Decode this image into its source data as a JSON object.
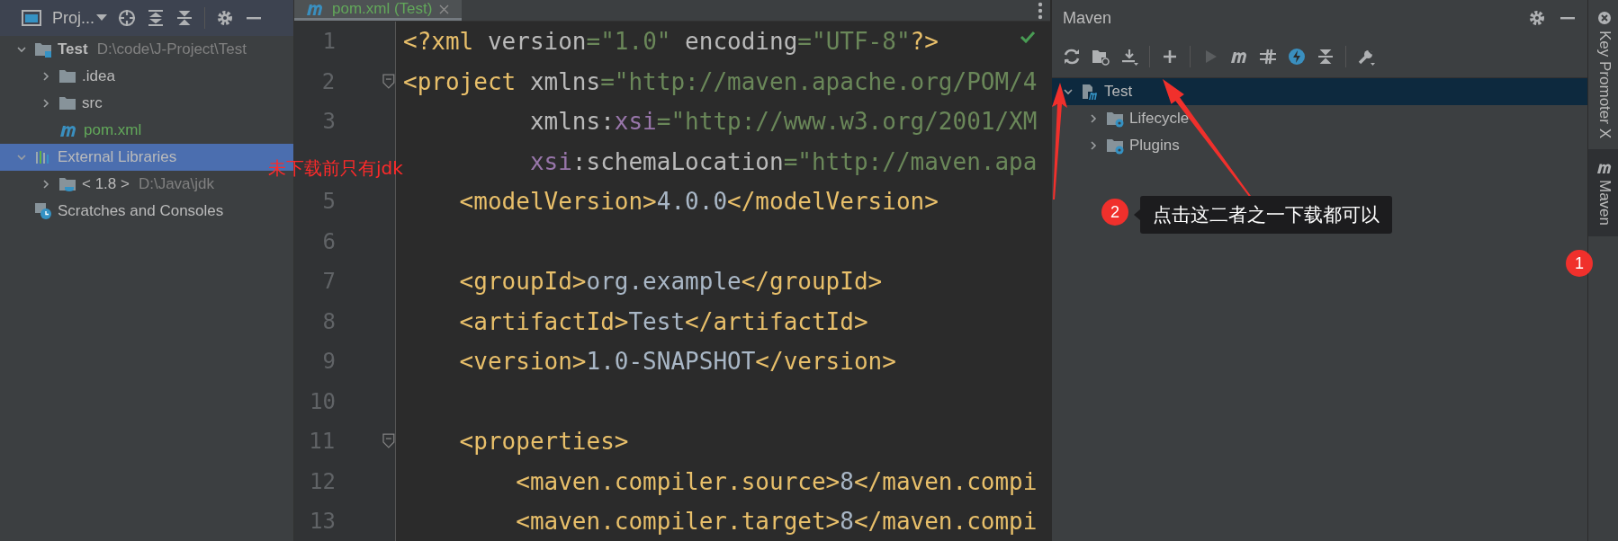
{
  "project_panel": {
    "title": "Proj...",
    "tree": [
      {
        "label": "Test",
        "path": "D:\\code\\J-Project\\Test",
        "kind": "module",
        "expanded": true,
        "selected": false,
        "children": [
          {
            "label": ".idea",
            "kind": "folder",
            "expanded": false,
            "selected": false
          },
          {
            "label": "src",
            "kind": "folder",
            "expanded": false,
            "selected": false
          },
          {
            "label": "pom.xml",
            "kind": "maven-file",
            "selected": false
          }
        ]
      },
      {
        "label": "External Libraries",
        "kind": "libraries",
        "expanded": true,
        "selected": true,
        "children": [
          {
            "label": "< 1.8 >",
            "path": "D:\\Java\\jdk",
            "kind": "jdk",
            "expanded": false,
            "selected": false
          }
        ]
      },
      {
        "label": "Scratches and Consoles",
        "kind": "scratches",
        "selected": false
      }
    ]
  },
  "editor": {
    "tabs": [
      {
        "label": "pom.xml (Test)",
        "selected": true
      }
    ],
    "lines": [
      {
        "number": "1",
        "tokens": [
          {
            "kind": "tag",
            "text": "<?xml"
          },
          {
            "kind": "attr",
            "text": " version"
          },
          {
            "kind": "value",
            "text": "=\"1.0\""
          },
          {
            "kind": "attr",
            "text": " encoding"
          },
          {
            "kind": "value",
            "text": "=\"UTF-8\""
          },
          {
            "kind": "tag",
            "text": "?>"
          }
        ]
      },
      {
        "number": "2",
        "fold": true,
        "tokens": [
          {
            "kind": "tag",
            "text": "<project"
          },
          {
            "kind": "attr",
            "text": " xmlns"
          },
          {
            "kind": "value",
            "text": "=\"http://maven.apache.org/POM/4"
          }
        ]
      },
      {
        "number": "3",
        "tokens": [
          {
            "kind": "attr",
            "text": "         xmlns:"
          },
          {
            "kind": "ns",
            "text": "xsi"
          },
          {
            "kind": "value",
            "text": "=\"http://www.w3.org/2001/XM"
          }
        ]
      },
      {
        "tokens": [
          {
            "kind": "ns",
            "text": "         xsi"
          },
          {
            "kind": "attr",
            "text": ":schemaLocation"
          },
          {
            "kind": "value",
            "text": "=\"http://maven.apa"
          }
        ]
      },
      {
        "number": "5",
        "tokens": [
          {
            "kind": "tag",
            "text": "    <modelVersion>"
          },
          {
            "kind": "text",
            "text": "4.0.0"
          },
          {
            "kind": "tag",
            "text": "</modelVersion>"
          }
        ]
      },
      {
        "number": "6"
      },
      {
        "number": "7",
        "tokens": [
          {
            "kind": "tag",
            "text": "    <groupId>"
          },
          {
            "kind": "text",
            "text": "org.example"
          },
          {
            "kind": "tag",
            "text": "</groupId>"
          }
        ]
      },
      {
        "number": "8",
        "tokens": [
          {
            "kind": "tag",
            "text": "    <artifactId>"
          },
          {
            "kind": "text",
            "text": "Test"
          },
          {
            "kind": "tag",
            "text": "</artifactId>"
          }
        ]
      },
      {
        "number": "9",
        "tokens": [
          {
            "kind": "tag",
            "text": "    <version>"
          },
          {
            "kind": "text",
            "text": "1.0-SNAPSHOT"
          },
          {
            "kind": "tag",
            "text": "</version>"
          }
        ]
      },
      {
        "number": "10"
      },
      {
        "number": "11",
        "fold": true,
        "tokens": [
          {
            "kind": "tag",
            "text": "    <properties>"
          }
        ]
      },
      {
        "number": "12",
        "tokens": [
          {
            "kind": "tag",
            "text": "        <maven.compiler.source>"
          },
          {
            "kind": "text",
            "text": "8"
          },
          {
            "kind": "tag",
            "text": "</maven.compi"
          }
        ]
      },
      {
        "number": "13",
        "tokens": [
          {
            "kind": "tag",
            "text": "        <maven.compiler.target>"
          },
          {
            "kind": "text",
            "text": "8"
          },
          {
            "kind": "tag",
            "text": "</maven.compi"
          }
        ]
      }
    ]
  },
  "maven_panel": {
    "title": "Maven",
    "tree": [
      {
        "label": "Test",
        "kind": "project",
        "expanded": true,
        "selected": true,
        "children": [
          {
            "label": "Lifecycle",
            "kind": "group",
            "expanded": false,
            "selected": false
          },
          {
            "label": "Plugins",
            "kind": "group",
            "expanded": false,
            "selected": false
          }
        ]
      }
    ]
  },
  "side_strip": {
    "tabs": [
      {
        "label": "Key Promoter X",
        "kind": "promoter",
        "selected": false
      },
      {
        "label": "Maven",
        "kind": "maven",
        "selected": true
      }
    ]
  },
  "annotations": {
    "note": "未下载前只有jdk",
    "callouts": [
      {
        "number": "1"
      },
      {
        "number": "2"
      }
    ],
    "tooltip": "点击这二者之一下载都可以"
  }
}
